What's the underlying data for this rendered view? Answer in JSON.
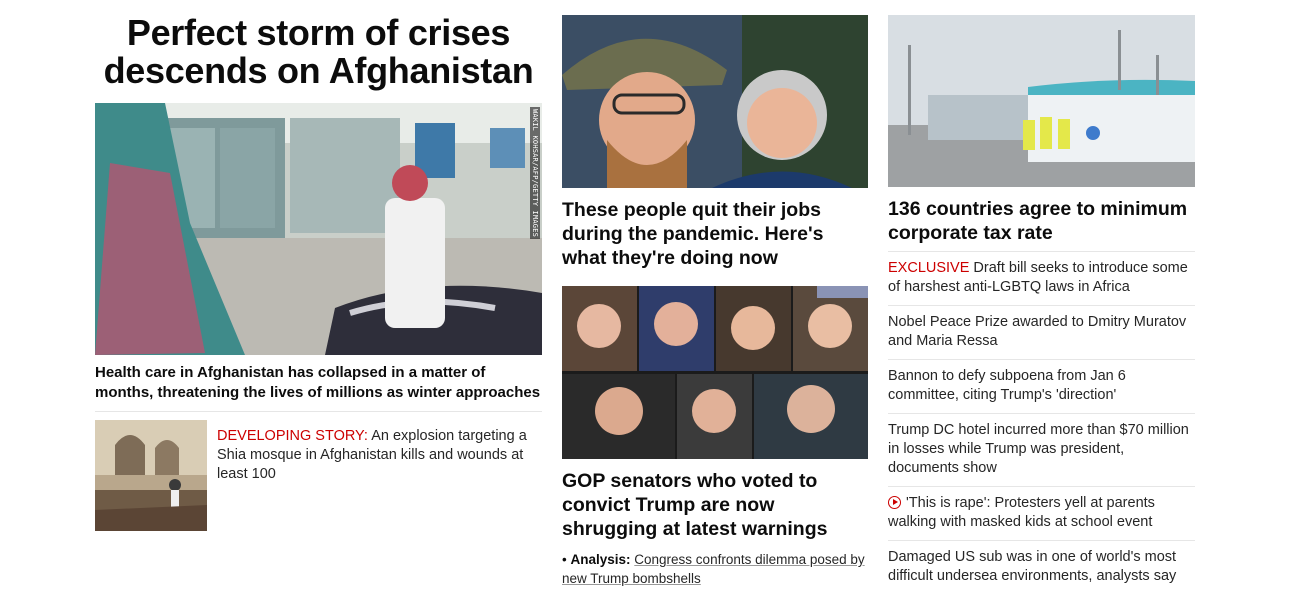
{
  "col1": {
    "headline": "Perfect storm of crises descends on Afghanistan",
    "hero_credit": "WAKIL KOHSAR/AFP/GETTY IMAGES",
    "hero_caption": "Health care in Afghanistan has collapsed in a matter of months, threatening the lives of millions as winter approaches",
    "story": {
      "tag": "DEVELOPING STORY:",
      "text": " An explosion targeting a Shia mosque in Afghanistan kills and wounds at least 100"
    }
  },
  "col2": {
    "story1": "These people quit their jobs during the pandemic. Here's what they're doing now",
    "story2": "GOP senators who voted to convict Trump are now shrugging at latest warnings",
    "analysis_label": "Analysis:",
    "analysis_text": "Congress confronts dilemma posed by new Trump bombshells"
  },
  "col3": {
    "lead": "136 countries agree to minimum corporate tax rate",
    "items": [
      {
        "tag": "EXCLUSIVE",
        "text": " Draft bill seeks to introduce some of harshest anti-LGBTQ laws in Africa"
      },
      {
        "text": "Nobel Peace Prize awarded to Dmitry Muratov and Maria Ressa"
      },
      {
        "text": "Bannon to defy subpoena from Jan 6 committee, citing Trump's 'direction'"
      },
      {
        "text": "Trump DC hotel incurred more than $70 million in losses while Trump was president, documents show"
      },
      {
        "text": "'This is rape': Protesters yell at parents walking with masked kids at school event",
        "icon": "play-icon"
      },
      {
        "text": "Damaged US sub was in one of world's most difficult undersea environments, analysts say"
      }
    ]
  },
  "colors": {
    "accent": "#cc0000",
    "text": "#0c0c0c",
    "rule": "#e6e6e6"
  }
}
